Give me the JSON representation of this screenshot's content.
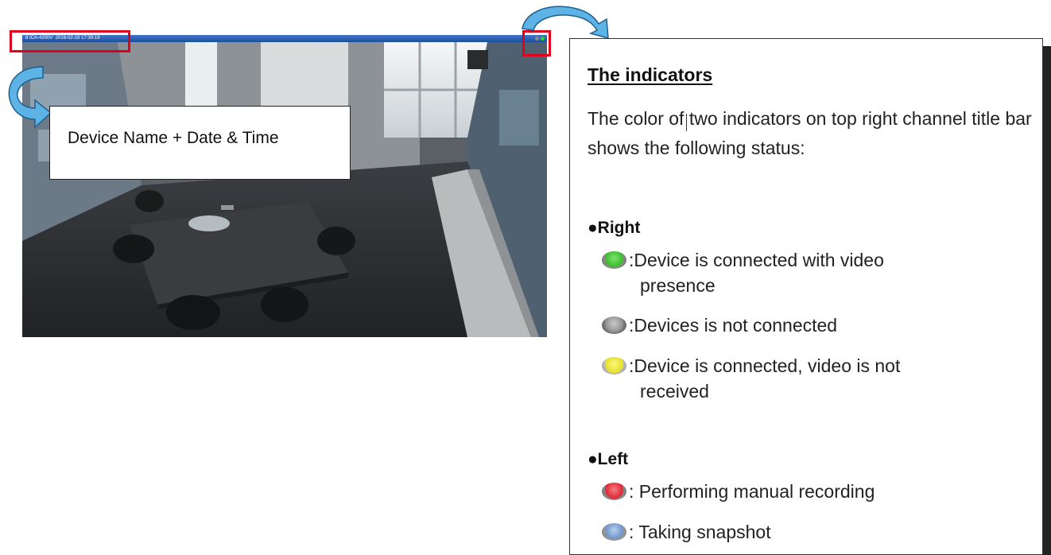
{
  "camera": {
    "title_text": "8 ICA-4200V  2016-02-19 17:39:19",
    "titlebar_color": "#1d4f9f",
    "indicator_left_color": "#8a8a8a",
    "indicator_right_color": "#2fd12f"
  },
  "callout": {
    "label": "Device Name + Date & Time"
  },
  "highlight_color": "#e0001b",
  "arrow_color": "#5db3e6",
  "panel": {
    "title": "The indicators",
    "description": "The color of two indicators on top right channel title bar shows the following status:",
    "right_section": {
      "label": "●Right",
      "items": [
        {
          "color": "green",
          "text_line1": ":Device is connected with video",
          "text_line2": "presence"
        },
        {
          "color": "grey",
          "text_line1": ":Devices is not connected"
        },
        {
          "color": "yellow",
          "text_line1": ":Device is connected, video is not",
          "text_line2": "received"
        }
      ]
    },
    "left_section": {
      "label": "●Left",
      "items": [
        {
          "color": "red",
          "text_line1": ": Performing manual recording"
        },
        {
          "color": "blue",
          "text_line1": ": Taking snapshot"
        }
      ]
    }
  }
}
